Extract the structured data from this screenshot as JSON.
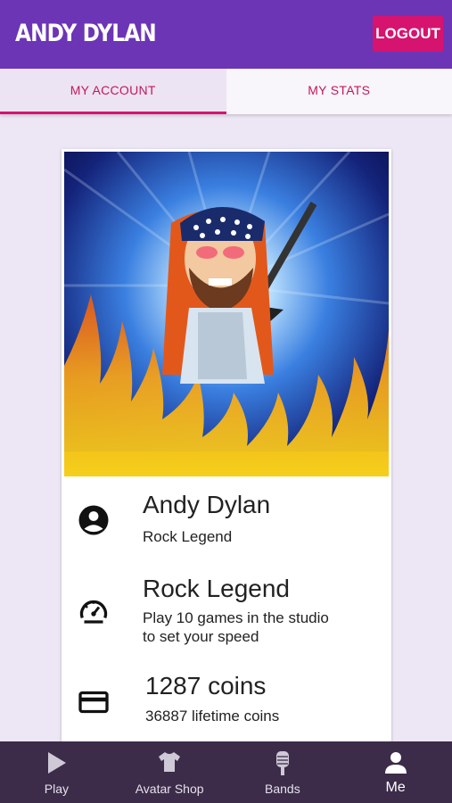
{
  "header": {
    "title": "ANDY DYLAN",
    "logout_label": "LOGOUT"
  },
  "tabs": [
    {
      "label": "MY ACCOUNT",
      "active": true
    },
    {
      "label": "MY STATS",
      "active": false
    }
  ],
  "profile": {
    "name": "Andy Dylan",
    "title": "Rock Legend"
  },
  "speed": {
    "level": "Rock Legend",
    "hint_line1": "Play 10 games in the studio",
    "hint_line2": "to set your speed"
  },
  "coins": {
    "current": "1287 coins",
    "lifetime": "36887 lifetime coins"
  },
  "icons": {
    "profile": "account-circle-icon",
    "speed": "speedometer-icon",
    "coins": "credit-card-icon"
  },
  "bottom_nav": [
    {
      "label": "Play",
      "icon": "play-icon"
    },
    {
      "label": "Avatar Shop",
      "icon": "shirt-icon"
    },
    {
      "label": "Bands",
      "icon": "microphone-icon"
    },
    {
      "label": "Me",
      "icon": "person-icon",
      "active": true
    }
  ],
  "colors": {
    "header": "#6c35b5",
    "accent": "#d6136f",
    "background": "#ede6f5",
    "bottom_nav": "#3c2c4a"
  }
}
